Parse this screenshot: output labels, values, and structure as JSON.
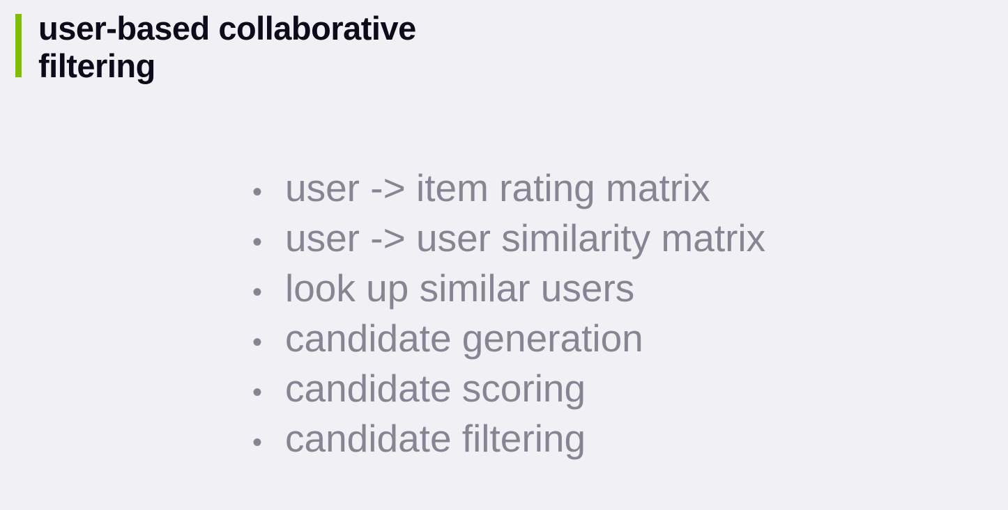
{
  "slide": {
    "title": "user-based collaborative filtering",
    "bullets": [
      "user -> item rating matrix",
      "user -> user similarity matrix",
      "look up similar users",
      "candidate generation",
      "candidate scoring",
      "candidate filtering"
    ],
    "bullet_glyph": "•"
  },
  "colors": {
    "background": "#f1f0f5",
    "accent": "#7fbe00",
    "title_text": "#0b0b1a",
    "bullet_text": "#878593"
  }
}
